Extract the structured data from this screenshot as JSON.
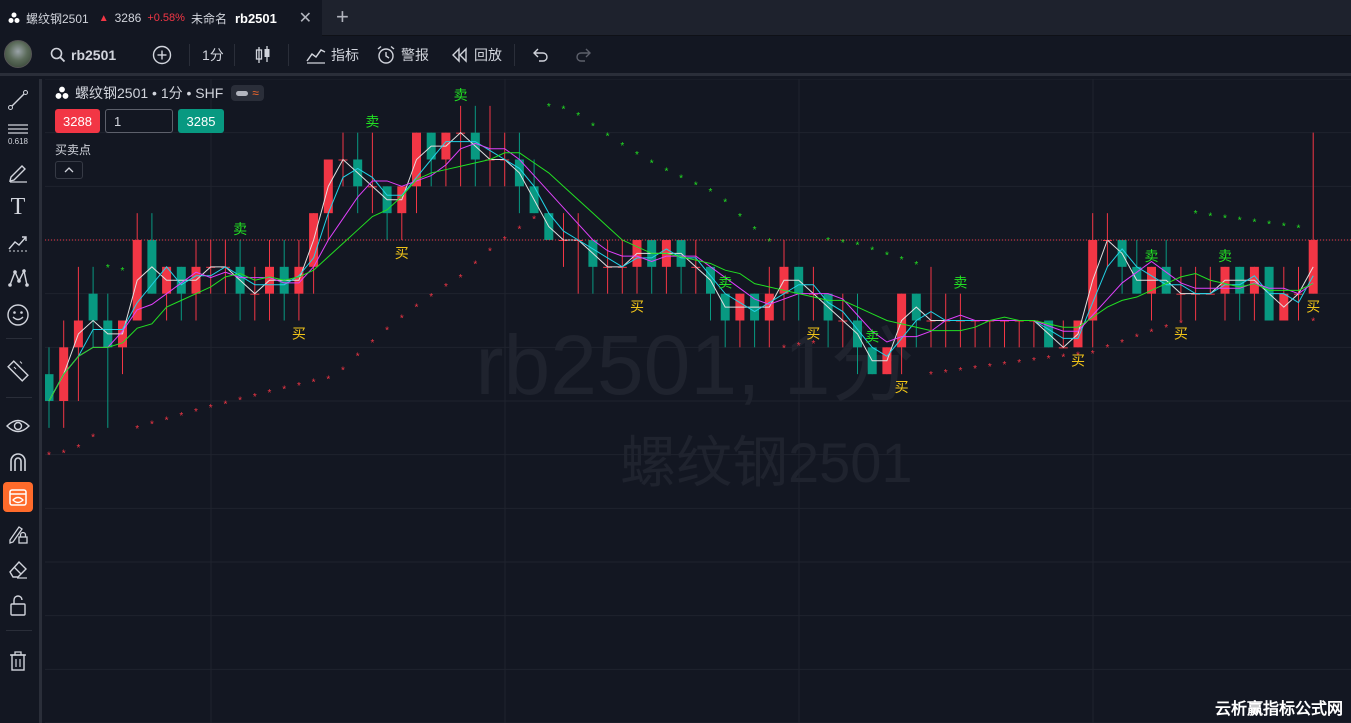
{
  "tab": {
    "symbol": "螺纹钢2501",
    "arrow": "▲",
    "price": "3286",
    "change": "+0.58%",
    "layout_name": "未命名",
    "code": "rb2501",
    "close": "✕",
    "new_tab": "+"
  },
  "toolbar": {
    "search_value": "rb2501",
    "interval": "1分",
    "indicators": "指标",
    "alerts": "警报",
    "replay": "回放"
  },
  "legend": {
    "title": "螺纹钢2501 • 1分 • SHF"
  },
  "order": {
    "sell_price": "3288",
    "quantity": "1",
    "buy_price": "3285"
  },
  "indicator": {
    "name": "买卖点"
  },
  "sidebar_tools": [
    {
      "icon": "trend-line-icon"
    },
    {
      "icon": "fib-retracement-icon",
      "label": "0.618"
    },
    {
      "icon": "brush-icon"
    },
    {
      "icon": "text-tool-icon",
      "label": "T"
    },
    {
      "icon": "forecast-icon"
    },
    {
      "icon": "pattern-icon"
    },
    {
      "icon": "emoji-icon"
    },
    {
      "icon": "ruler-icon"
    },
    {
      "icon": "eye-icon"
    },
    {
      "icon": "magnet-icon"
    },
    {
      "icon": "hide-drawings-icon"
    },
    {
      "icon": "lock-edit-icon"
    },
    {
      "icon": "eraser-icon"
    },
    {
      "icon": "lock-icon"
    },
    {
      "icon": "trash-icon"
    }
  ],
  "chart_data": {
    "type": "candlestick",
    "colors": {
      "up": "#f23645",
      "down": "#089981",
      "ma_fast": "#e0e0e0",
      "ma_mid": "#22d3e6",
      "ma_slow": "#e040fb",
      "ma_long": "#22e022",
      "sar_bull": "#f23645",
      "sar_bear": "#22e022",
      "buy_text": "#f0c419",
      "sell_text": "#22e022",
      "last_price_line": "#f23645"
    },
    "watermark_code": "rb2501, 1分",
    "watermark_name": "螺纹钢2501",
    "last_price": 3286,
    "ylim": [
      3268,
      3292
    ],
    "candles": [
      [
        3281,
        3282,
        3279,
        3280
      ],
      [
        3280,
        3283,
        3279,
        3282
      ],
      [
        3282,
        3285,
        3280,
        3283
      ],
      [
        3284,
        3285,
        3282,
        3283
      ],
      [
        3283,
        3284,
        3279,
        3282
      ],
      [
        3282,
        3283,
        3281,
        3283
      ],
      [
        3283,
        3287,
        3283,
        3286
      ],
      [
        3286,
        3287,
        3284,
        3284
      ],
      [
        3284,
        3285,
        3283,
        3285
      ],
      [
        3285,
        3285,
        3283,
        3284
      ],
      [
        3284,
        3286,
        3283,
        3285
      ],
      [
        3285,
        3286,
        3284,
        3285
      ],
      [
        3285,
        3286,
        3284,
        3285
      ],
      [
        3285,
        3286,
        3283,
        3284
      ],
      [
        3284,
        3285,
        3283,
        3284
      ],
      [
        3284,
        3286,
        3283,
        3285
      ],
      [
        3285,
        3286,
        3283,
        3284
      ],
      [
        3284,
        3286,
        3283,
        3285
      ],
      [
        3285,
        3287,
        3284,
        3287
      ],
      [
        3287,
        3289,
        3286,
        3289
      ],
      [
        3289,
        3290,
        3288,
        3289
      ],
      [
        3289,
        3290,
        3287,
        3288
      ],
      [
        3288,
        3290,
        3287,
        3288
      ],
      [
        3288,
        3288,
        3286,
        3287
      ],
      [
        3287,
        3288,
        3286,
        3288
      ],
      [
        3288,
        3290,
        3287,
        3290
      ],
      [
        3290,
        3290,
        3288,
        3289
      ],
      [
        3289,
        3290,
        3288,
        3290
      ],
      [
        3290,
        3291,
        3288,
        3290
      ],
      [
        3290,
        3291,
        3288,
        3289
      ],
      [
        3289,
        3291,
        3288,
        3289
      ],
      [
        3289,
        3290,
        3288,
        3289
      ],
      [
        3289,
        3290,
        3287,
        3288
      ],
      [
        3288,
        3289,
        3287,
        3287
      ],
      [
        3287,
        3287,
        3286,
        3286
      ],
      [
        3286,
        3287,
        3285,
        3286
      ],
      [
        3286,
        3287,
        3284,
        3286
      ],
      [
        3286,
        3286,
        3284,
        3285
      ],
      [
        3285,
        3286,
        3284,
        3285
      ],
      [
        3285,
        3286,
        3284,
        3285
      ],
      [
        3285,
        3286,
        3284,
        3286
      ],
      [
        3286,
        3286,
        3284,
        3285
      ],
      [
        3285,
        3286,
        3284,
        3286
      ],
      [
        3286,
        3286,
        3284,
        3285
      ],
      [
        3285,
        3286,
        3284,
        3285
      ],
      [
        3285,
        3285,
        3283,
        3284
      ],
      [
        3284,
        3284,
        3282,
        3283
      ],
      [
        3283,
        3284,
        3282,
        3284
      ],
      [
        3284,
        3284,
        3282,
        3283
      ],
      [
        3283,
        3285,
        3282,
        3284
      ],
      [
        3284,
        3286,
        3283,
        3285
      ],
      [
        3285,
        3285,
        3283,
        3284
      ],
      [
        3284,
        3285,
        3283,
        3284
      ],
      [
        3284,
        3284,
        3282,
        3283
      ],
      [
        3283,
        3284,
        3282,
        3283
      ],
      [
        3283,
        3284,
        3281,
        3282
      ],
      [
        3282,
        3282,
        3281,
        3281
      ],
      [
        3281,
        3282,
        3281,
        3282
      ],
      [
        3282,
        3284,
        3281,
        3284
      ],
      [
        3284,
        3284,
        3282,
        3283
      ],
      [
        3283,
        3285,
        3282,
        3283
      ],
      [
        3283,
        3284,
        3282,
        3283
      ],
      [
        3283,
        3284,
        3282,
        3283
      ],
      [
        3283,
        3283,
        3282,
        3283
      ],
      [
        3283,
        3283,
        3282,
        3283
      ],
      [
        3283,
        3283,
        3282,
        3283
      ],
      [
        3283,
        3283,
        3282,
        3283
      ],
      [
        3283,
        3283,
        3282,
        3283
      ],
      [
        3283,
        3283,
        3282,
        3282
      ],
      [
        3282,
        3283,
        3282,
        3282
      ],
      [
        3282,
        3283,
        3282,
        3283
      ],
      [
        3283,
        3287,
        3282,
        3286
      ],
      [
        3286,
        3287,
        3285,
        3286
      ],
      [
        3286,
        3286,
        3284,
        3285
      ],
      [
        3285,
        3286,
        3284,
        3284
      ],
      [
        3284,
        3285,
        3283,
        3285
      ],
      [
        3285,
        3286,
        3284,
        3284
      ],
      [
        3284,
        3285,
        3283,
        3284
      ],
      [
        3284,
        3285,
        3283,
        3284
      ],
      [
        3284,
        3285,
        3284,
        3284
      ],
      [
        3284,
        3285,
        3283,
        3285
      ],
      [
        3285,
        3285,
        3283,
        3284
      ],
      [
        3284,
        3285,
        3283,
        3285
      ],
      [
        3285,
        3285,
        3283,
        3283
      ],
      [
        3283,
        3285,
        3283,
        3284
      ],
      [
        3284,
        3285,
        3283,
        3284
      ],
      [
        3284,
        3290,
        3284,
        3286
      ]
    ],
    "signals": [
      {
        "i": 17,
        "text": "买",
        "kind": "buy"
      },
      {
        "i": 13,
        "text": "卖",
        "kind": "sell"
      },
      {
        "i": 24,
        "text": "买",
        "kind": "buy"
      },
      {
        "i": 28,
        "text": "卖",
        "kind": "sell"
      },
      {
        "i": 22,
        "text": "卖",
        "kind": "sell"
      },
      {
        "i": 40,
        "text": "买",
        "kind": "buy"
      },
      {
        "i": 46,
        "text": "卖",
        "kind": "sell"
      },
      {
        "i": 52,
        "text": "买",
        "kind": "buy"
      },
      {
        "i": 56,
        "text": "卖",
        "kind": "sell"
      },
      {
        "i": 58,
        "text": "买",
        "kind": "buy"
      },
      {
        "i": 62,
        "text": "卖",
        "kind": "sell"
      },
      {
        "i": 70,
        "text": "买",
        "kind": "buy"
      },
      {
        "i": 75,
        "text": "卖",
        "kind": "sell"
      },
      {
        "i": 77,
        "text": "买",
        "kind": "buy"
      },
      {
        "i": 80,
        "text": "卖",
        "kind": "sell"
      },
      {
        "i": 86,
        "text": "买",
        "kind": "buy"
      }
    ]
  },
  "footer_watermark": "云析赢指标公式网"
}
